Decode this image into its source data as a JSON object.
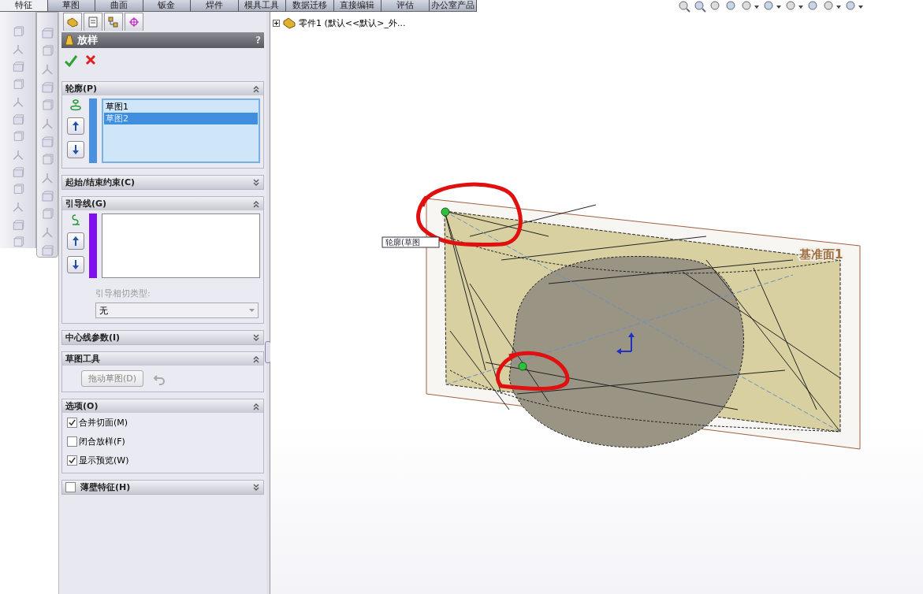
{
  "command_tabs": [
    {
      "label": "特征",
      "selected": true
    },
    {
      "label": "草图",
      "selected": false
    },
    {
      "label": "曲面",
      "selected": false
    },
    {
      "label": "钣金",
      "selected": false
    },
    {
      "label": "焊件",
      "selected": false
    },
    {
      "label": "模具工具",
      "selected": false
    },
    {
      "label": "数据迁移",
      "selected": false
    },
    {
      "label": "直接编辑",
      "selected": false
    },
    {
      "label": "评估",
      "selected": false
    },
    {
      "label": "办公室产品",
      "selected": false
    }
  ],
  "feature_tree": {
    "root": "零件1 (默认<<默认>_外..."
  },
  "property_manager": {
    "title": "放样",
    "help": "?",
    "sections": [
      {
        "kind": "profiles",
        "title": "轮廓(P)",
        "expanded": true,
        "items": [
          {
            "label": "草图1",
            "selected": false
          },
          {
            "label": "草图2",
            "selected": true
          }
        ]
      },
      {
        "kind": "plain",
        "title": "起始/结束约束(C)",
        "expanded": false
      },
      {
        "kind": "guides",
        "title": "引导线(G)",
        "expanded": true,
        "tangency_label": "引导相切类型:",
        "tangency_value": "无",
        "disabled": true
      },
      {
        "kind": "plain",
        "title": "中心线参数(I)",
        "expanded": false
      },
      {
        "kind": "tools",
        "title": "草图工具",
        "expanded": true,
        "button": "拖动草图(D)",
        "disabled": true
      },
      {
        "kind": "options",
        "title": "选项(O)",
        "expanded": true,
        "options": [
          {
            "label": "合并切面(M)",
            "checked": true
          },
          {
            "label": "闭合放样(F)",
            "checked": false
          },
          {
            "label": "显示预览(W)",
            "checked": true
          }
        ]
      },
      {
        "kind": "thin",
        "title": "薄壁特征(H)",
        "expanded": false,
        "checked": false
      }
    ]
  },
  "viewport": {
    "plane_label": "基准面1",
    "callout": "轮廓(草图"
  }
}
